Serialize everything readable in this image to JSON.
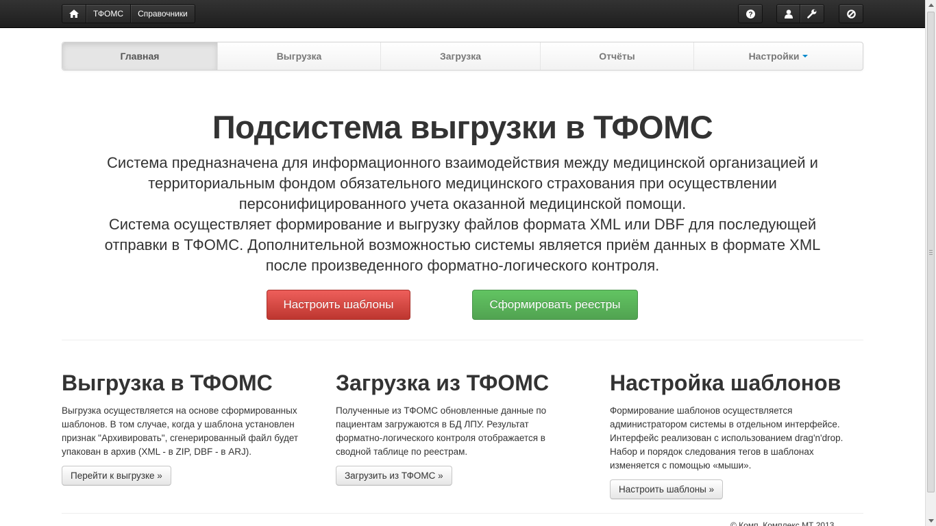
{
  "topbar": {
    "left": [
      "ТФОМС",
      "Справочники"
    ],
    "icons": [
      "home-icon",
      "help-icon",
      "user-icon",
      "wrench-icon",
      "ban-icon"
    ]
  },
  "nav": {
    "tabs": [
      "Главная",
      "Выгрузка",
      "Загрузка",
      "Отчёты",
      "Настройки"
    ],
    "active": "Главная"
  },
  "hero": {
    "title": "Подсистема выгрузки в ТФОМС",
    "lines": [
      "Система предназначена для информационного взаимодействия между медицинской организацией и",
      "территориальным фондом обязательного медицинского страхования при осуществлении",
      "персонифицированного учета оказанной медицинской помощи.",
      "Система осуществляет формирование и выгрузку файлов формата XML или DBF для последующей",
      "отправки в ТФОМС. Дополнительной возможностью системы является приём данных в формате XML",
      "после произведенного форматно-логического контроля."
    ],
    "btn_templates": "Настроить шаблоны",
    "btn_registers": "Сформировать реестры"
  },
  "columns": [
    {
      "title": "Выгрузка в ТФОМС",
      "lines": [
        "Выгрузка осуществляется на основе сформированных",
        "шаблонов. В том случае, когда у шаблона установлен",
        "признак \"Архивировать\", сгенерированный файл будет",
        "упакован в архив (XML - в ZIP, DBF - в ARJ)."
      ],
      "button": "Перейти к выгрузке »"
    },
    {
      "title": "Загрузка из ТФОМС",
      "lines": [
        "Полученные из ТФОМС обновленные данные по",
        "пациентам загружаются в БД ЛПУ. Результат",
        "форматно-логического контроля отображается в",
        "сводной таблице по реестрам."
      ],
      "button": "Загрузить из ТФОМС »"
    },
    {
      "title": "Настройка шаблонов",
      "lines": [
        "Формирование шаблонов осуществляется",
        "администратором системы в отдельном интерфейсе.",
        "Интерфейс реализован с использованием drag'n'drop.",
        "Набор и порядок следования тегов в шаблонах",
        "изменяется с помощью «мыши»."
      ],
      "button": "Настроить шаблоны »"
    }
  ],
  "footer": {
    "text": "© Комп. Комплекс МТ 2013"
  },
  "colors": {
    "topbar": "#222222",
    "danger": "#da4f49",
    "success": "#5bb75b",
    "caret": "#0088cc"
  }
}
